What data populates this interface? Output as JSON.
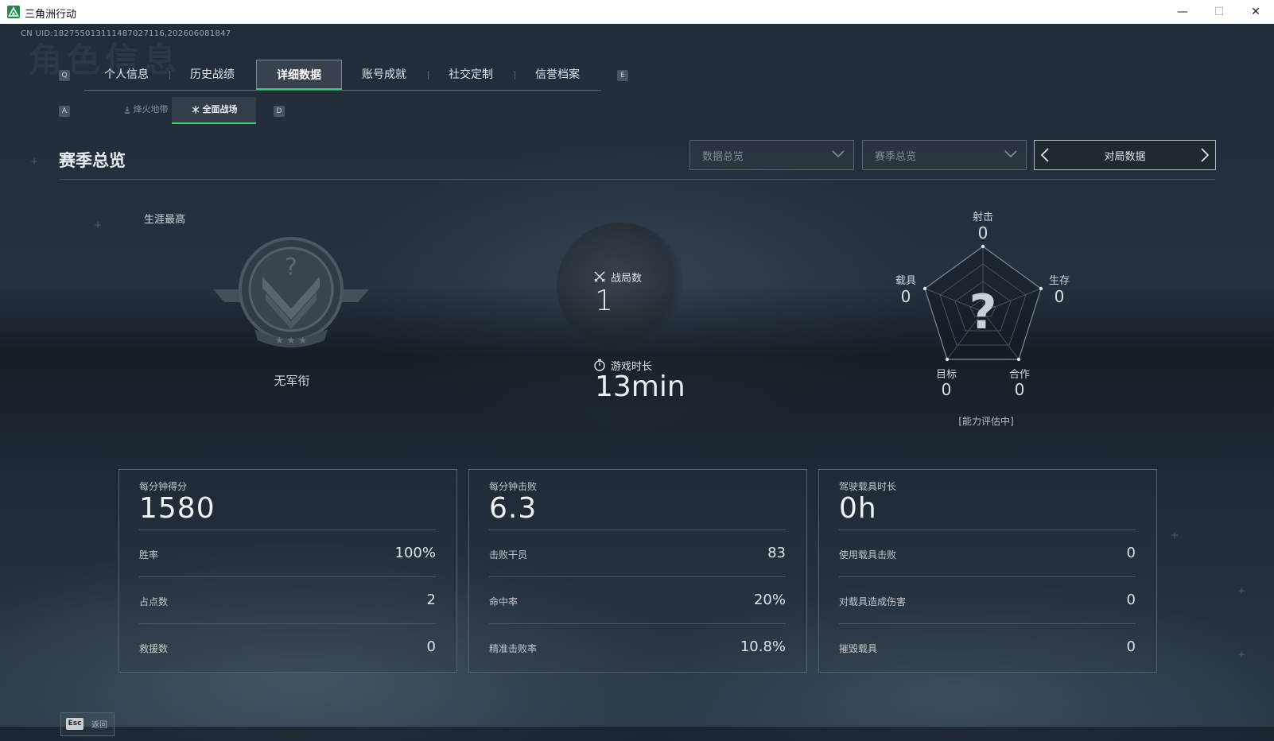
{
  "window": {
    "title": "三角洲行动",
    "minimize_symbol": "—",
    "maximize_symbol": "☐",
    "close_symbol": "✕"
  },
  "uid_text": "CN UID:1827550131114870271​16,202606081847",
  "watermark_text": "角色信息",
  "main_tabs": {
    "prev_key": "Q",
    "next_key": "E",
    "items": [
      "个人信息",
      "历史战绩",
      "详细数据",
      "账号成就",
      "社交定制",
      "信誉档案"
    ],
    "active_index": 2
  },
  "sub_tabs": {
    "prev_key": "A",
    "next_key": "D",
    "items": [
      "烽火地带",
      "全面战场"
    ],
    "active_index": 1
  },
  "section_title": "赛季总览",
  "filters": {
    "dropdown_1": "数据总览",
    "dropdown_2": "赛季总览",
    "pager_label": "对局数据"
  },
  "rank": {
    "career_label": "生涯最高",
    "name": "无军衔"
  },
  "summary": {
    "matches_label": "战局数",
    "matches_value": "1",
    "playtime_label": "游戏时长",
    "playtime_value": "13min"
  },
  "radar": {
    "center_symbol": "?",
    "status": "[能力评估中]",
    "axes": [
      {
        "label": "射击",
        "value": "0"
      },
      {
        "label": "生存",
        "value": "0"
      },
      {
        "label": "合作",
        "value": "0"
      },
      {
        "label": "目标",
        "value": "0"
      },
      {
        "label": "载具",
        "value": "0"
      }
    ]
  },
  "cards": [
    {
      "title": "每分钟得分",
      "value": "1580",
      "rows": [
        {
          "label": "胜率",
          "value": "100%"
        },
        {
          "label": "占点数",
          "value": "2"
        },
        {
          "label": "救援数",
          "value": "0"
        }
      ]
    },
    {
      "title": "每分钟击败",
      "value": "6.3",
      "rows": [
        {
          "label": "击败干员",
          "value": "83"
        },
        {
          "label": "命中率",
          "value": "20%"
        },
        {
          "label": "精准击败率",
          "value": "10.8%"
        }
      ]
    },
    {
      "title": "驾驶载具时长",
      "value": "0h",
      "rows": [
        {
          "label": "使用载具击败",
          "value": "0"
        },
        {
          "label": "对载具造成伤害",
          "value": "0"
        },
        {
          "label": "摧毁载具",
          "value": "0"
        }
      ]
    }
  ],
  "footer": {
    "esc_key": "Esc",
    "back_label": "返回"
  }
}
